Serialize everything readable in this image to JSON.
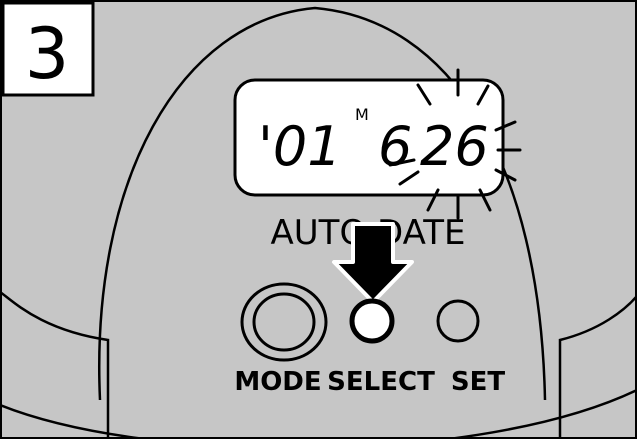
{
  "step": {
    "number": "3"
  },
  "lcd": {
    "year": "'01",
    "month_marker": "M",
    "month": "6",
    "day": "26"
  },
  "labels": {
    "auto_date": "AUTO DATE",
    "mode": "MODE",
    "select": "SELECT",
    "set": "SET"
  },
  "colors": {
    "panel": "#c6c6c6",
    "stroke": "#000000",
    "lcd_face": "#ffffff",
    "highlight_button": "#ffffff"
  },
  "icons": {
    "arrow": "down-arrow-icon",
    "blink": "blink-rays-icon"
  }
}
